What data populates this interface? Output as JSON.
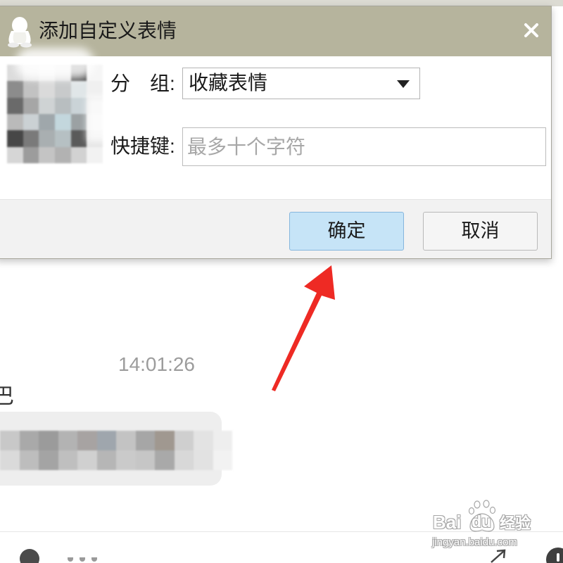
{
  "dialog": {
    "title": "添加自定义表情",
    "group": {
      "label": "分　组:",
      "value": "收藏表情"
    },
    "shortcut": {
      "label": "快捷键:",
      "placeholder": "最多十个字符"
    },
    "buttons": {
      "ok": "确定",
      "cancel": "取消"
    }
  },
  "chat": {
    "timestamp": "14:01:26",
    "sender_fragment": "巴"
  },
  "watermark": {
    "brand_left": "Bai",
    "brand_paw_text": "du",
    "product": "经验",
    "url": "jingyan.baidu.com"
  },
  "icons": {
    "title_bar": "qq-penguin-icon",
    "close": "close-icon",
    "dropdown": "chevron-down-icon",
    "watermark": "baidu-paw-icon",
    "annotation": "red-arrow",
    "toolbar": [
      "user-icon",
      "more-icon",
      "expand-icon",
      "info-icon"
    ]
  },
  "colors": {
    "title_bar": "#b6b49d",
    "ok_button": "#c6e4f7",
    "annotation_arrow": "#ee2a24",
    "timestamp": "#9c9c9c",
    "bubble": "#eeeeee"
  }
}
